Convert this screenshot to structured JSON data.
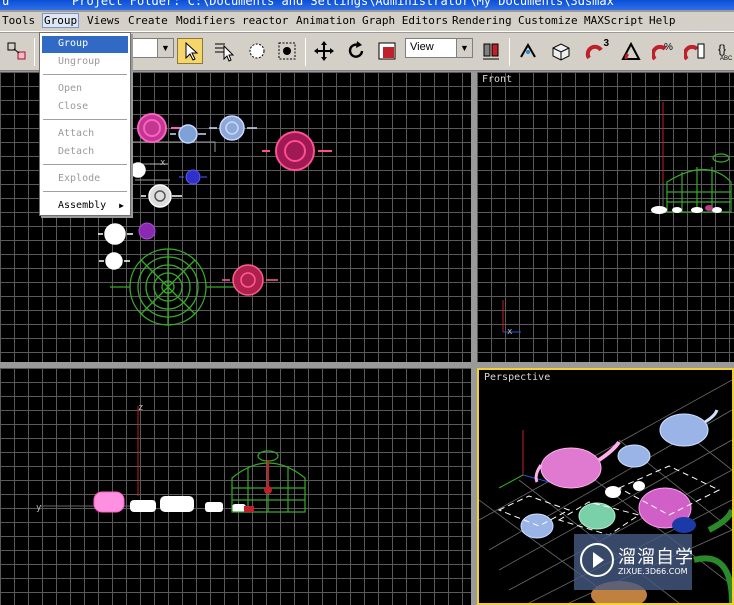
{
  "titlebar": {
    "left_fragment": "u",
    "text": "Project Folder: C:\\Documents and Settings\\Administrator\\My Documents\\3dsmax"
  },
  "menubar": {
    "items": [
      "Tools",
      "Group",
      "Views",
      "Create",
      "Modifiers",
      "reactor",
      "Animation",
      "Graph Editors",
      "Rendering",
      "Customize",
      "MAXScript",
      "Help"
    ],
    "active": "Group"
  },
  "toolbar": {
    "view_combo": "View",
    "icons": [
      "link-icon",
      "filter-combo",
      "select-arrow-icon",
      "select-by-name-icon",
      "region-select-icon",
      "window-crossing-icon",
      "move-icon",
      "rotate-icon",
      "scale-icon",
      "reference-coord-combo",
      "pivot-icon",
      "mirror-icon",
      "align-icon",
      "snap-3d-icon",
      "angle-snap-icon",
      "percent-snap-icon",
      "spinner-snap-icon",
      "named-selection-icon"
    ],
    "snap_label": "3",
    "edge_label": "ABC"
  },
  "group_menu": {
    "items": [
      {
        "label": "Group",
        "state": "highlighted"
      },
      {
        "label": "Ungroup",
        "state": "disabled"
      },
      {
        "label": "Open",
        "state": "disabled"
      },
      {
        "label": "Close",
        "state": "disabled"
      },
      {
        "label": "Attach",
        "state": "disabled"
      },
      {
        "label": "Detach",
        "state": "disabled"
      },
      {
        "label": "Explode",
        "state": "disabled"
      },
      {
        "label": "Assembly",
        "state": "normal",
        "submenu": true
      }
    ]
  },
  "viewports": {
    "top": {
      "label": ""
    },
    "front": {
      "label": "Front"
    },
    "left": {
      "label": ""
    },
    "perspective": {
      "label": "Perspective"
    }
  },
  "axis_labels": {
    "x": "x",
    "y": "y",
    "z": "z"
  },
  "colors": {
    "menu_highlight": "#316ac5",
    "active_viewport_border": "#f2d034",
    "grid_line": "#5a5a5a",
    "viewport_bg": "#000000"
  },
  "watermark": {
    "name": "溜溜自学",
    "site": "ZIXUE.3D66.COM"
  }
}
